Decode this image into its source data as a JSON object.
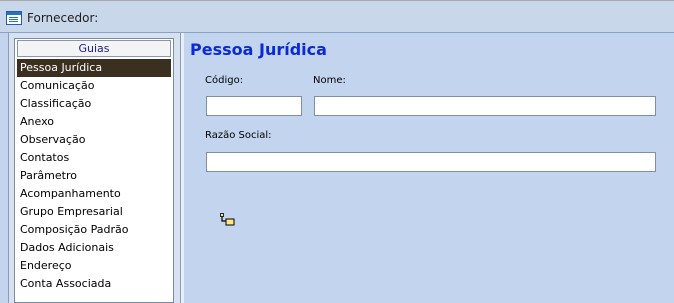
{
  "window": {
    "title": "Fornecedor:",
    "icon": "form-window-icon"
  },
  "nav": {
    "header": "Guias",
    "items": [
      {
        "label": "Pessoa Jurídica",
        "active": true
      },
      {
        "label": "Comunicação"
      },
      {
        "label": "Classificação"
      },
      {
        "label": "Anexo"
      },
      {
        "label": "Observação"
      },
      {
        "label": "Contatos"
      },
      {
        "label": "Parâmetro"
      },
      {
        "label": "Acompanhamento"
      },
      {
        "label": "Grupo Empresarial"
      },
      {
        "label": "Composição Padrão"
      },
      {
        "label": "Dados Adicionais"
      },
      {
        "label": "Endereço"
      },
      {
        "label": "Conta Associada"
      }
    ]
  },
  "form": {
    "title": "Pessoa Jurídica",
    "codigo": {
      "label": "Código:",
      "value": ""
    },
    "nome": {
      "label": "Nome:",
      "value": ""
    },
    "razao_social": {
      "label": "Razão Social:",
      "value": ""
    }
  },
  "colors": {
    "background": "#c3d5ee",
    "title_blue": "#0a2ad6",
    "active_item": "#3b3020"
  },
  "cursor_icon": "drag-link-cursor-icon"
}
